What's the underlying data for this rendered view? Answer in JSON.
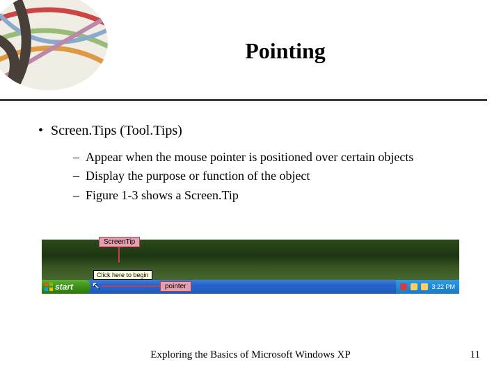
{
  "title": "Pointing",
  "bullet": {
    "main": "Screen.Tips (Tool.Tips)",
    "subs": [
      "Appear when the mouse pointer is positioned over certain objects",
      "Display the purpose or function of the object",
      "Figure 1-3 shows a Screen.Tip"
    ]
  },
  "callouts": {
    "screentip": "ScreenTip",
    "pointer": "pointer"
  },
  "tooltip_text": "Click here to begin",
  "start_label": "start",
  "systray_time": "3:22 PM",
  "footer": "Exploring the Basics of Microsoft Windows XP",
  "page_number": "11"
}
